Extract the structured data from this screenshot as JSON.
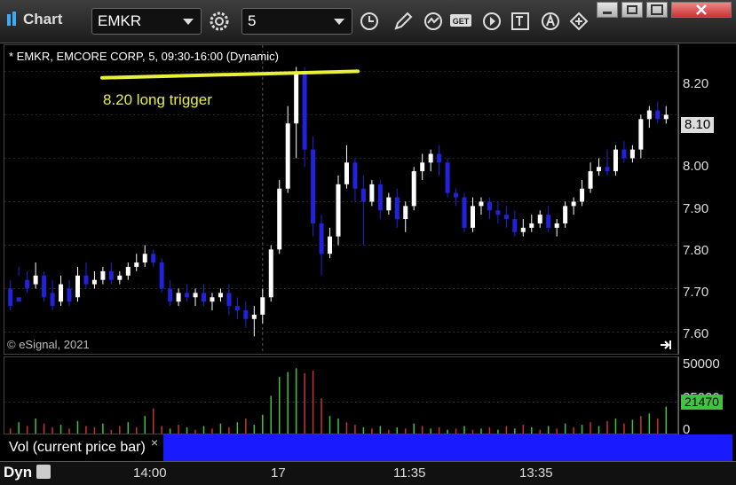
{
  "toolbar": {
    "app_title": "Chart",
    "symbol_value": "EMKR",
    "interval_value": "5",
    "icons": [
      "settings-gear-icon",
      "clock-icon",
      "pencil-icon",
      "study-icon",
      "get-icon",
      "play-icon",
      "text-tool-icon",
      "alert-icon",
      "cursor-icon"
    ]
  },
  "chart_header": "* EMKR, EMCORE CORP, 5, 09:30-16:00 (Dynamic)",
  "annotation": "8.20 long trigger",
  "copyright": "© eSignal, 2021",
  "price_axis": {
    "ticks": [
      "8.20",
      "8.10",
      "8.00",
      "7.90",
      "7.80",
      "7.70",
      "7.60"
    ],
    "current_price": "8.10"
  },
  "volume_axis": {
    "ticks": [
      "50000",
      "25000",
      "0"
    ],
    "current_volume": "21470"
  },
  "volume_label": "Vol (current price bar)",
  "x_axis": {
    "labels": [
      "14:00",
      "17",
      "11:35",
      "13:35"
    ],
    "mode_label": "Dyn"
  },
  "colors": {
    "up": "#ffffff",
    "down": "#2222dd",
    "trigger_line": "#e8f03a",
    "vol_up": "#3ec43e",
    "vol_down": "#c83232"
  },
  "chart_data": {
    "type": "candlestick",
    "ylim": [
      7.55,
      8.26
    ],
    "candles": [
      [
        7.7,
        7.72,
        7.66,
        7.65
      ],
      [
        7.68,
        7.75,
        7.67,
        7.73
      ],
      [
        7.72,
        7.74,
        7.7,
        7.69
      ],
      [
        7.71,
        7.76,
        7.73,
        7.7
      ],
      [
        7.73,
        7.74,
        7.68,
        7.67
      ],
      [
        7.69,
        7.72,
        7.66,
        7.65
      ],
      [
        7.67,
        7.73,
        7.71,
        7.66
      ],
      [
        7.7,
        7.72,
        7.67,
        7.66
      ],
      [
        7.68,
        7.75,
        7.73,
        7.67
      ],
      [
        7.73,
        7.76,
        7.71,
        7.7
      ],
      [
        7.71,
        7.74,
        7.72,
        7.7
      ],
      [
        7.72,
        7.75,
        7.74,
        7.71
      ],
      [
        7.74,
        7.76,
        7.72,
        7.71
      ],
      [
        7.72,
        7.74,
        7.73,
        7.71
      ],
      [
        7.73,
        7.76,
        7.75,
        7.72
      ],
      [
        7.75,
        7.78,
        7.76,
        7.74
      ],
      [
        7.76,
        7.8,
        7.78,
        7.75
      ],
      [
        7.78,
        7.79,
        7.76,
        7.75
      ],
      [
        7.76,
        7.77,
        7.7,
        7.69
      ],
      [
        7.7,
        7.72,
        7.67,
        7.66
      ],
      [
        7.67,
        7.7,
        7.69,
        7.66
      ],
      [
        7.69,
        7.71,
        7.68,
        7.67
      ],
      [
        7.68,
        7.7,
        7.69,
        7.66
      ],
      [
        7.69,
        7.71,
        7.67,
        7.66
      ],
      [
        7.67,
        7.69,
        7.68,
        7.65
      ],
      [
        7.68,
        7.7,
        7.69,
        7.67
      ],
      [
        7.69,
        7.71,
        7.66,
        7.64
      ],
      [
        7.66,
        7.68,
        7.65,
        7.63
      ],
      [
        7.65,
        7.67,
        7.63,
        7.61
      ],
      [
        7.63,
        7.66,
        7.64,
        7.59
      ],
      [
        7.64,
        7.7,
        7.68,
        7.62
      ],
      [
        7.68,
        7.8,
        7.79,
        7.67
      ],
      [
        7.79,
        7.95,
        7.93,
        7.78
      ],
      [
        7.93,
        8.12,
        8.08,
        7.92
      ],
      [
        8.08,
        8.21,
        8.2,
        8.0
      ],
      [
        8.2,
        8.21,
        8.02,
        7.98
      ],
      [
        8.02,
        8.05,
        7.85,
        7.82
      ],
      [
        7.85,
        7.87,
        7.78,
        7.73
      ],
      [
        7.78,
        7.84,
        7.82,
        7.77
      ],
      [
        7.82,
        7.96,
        7.94,
        7.8
      ],
      [
        7.94,
        8.03,
        7.99,
        7.93
      ],
      [
        7.99,
        8.0,
        7.93,
        7.9
      ],
      [
        7.93,
        7.96,
        7.9,
        7.8
      ],
      [
        7.9,
        7.95,
        7.94,
        7.89
      ],
      [
        7.94,
        7.95,
        7.88,
        7.86
      ],
      [
        7.88,
        7.92,
        7.91,
        7.87
      ],
      [
        7.91,
        7.93,
        7.86,
        7.84
      ],
      [
        7.86,
        7.9,
        7.89,
        7.83
      ],
      [
        7.89,
        7.98,
        7.97,
        7.88
      ],
      [
        7.97,
        8.01,
        7.99,
        7.95
      ],
      [
        7.99,
        8.02,
        8.01,
        7.97
      ],
      [
        8.01,
        8.03,
        7.99,
        7.96
      ],
      [
        7.99,
        8.0,
        7.92,
        7.91
      ],
      [
        7.92,
        7.93,
        7.91,
        7.89
      ],
      [
        7.91,
        7.92,
        7.84,
        7.83
      ],
      [
        7.84,
        7.91,
        7.89,
        7.83
      ],
      [
        7.89,
        7.91,
        7.9,
        7.87
      ],
      [
        7.9,
        7.91,
        7.88,
        7.86
      ],
      [
        7.88,
        7.9,
        7.87,
        7.85
      ],
      [
        7.87,
        7.89,
        7.86,
        7.84
      ],
      [
        7.86,
        7.88,
        7.83,
        7.82
      ],
      [
        7.83,
        7.86,
        7.84,
        7.82
      ],
      [
        7.84,
        7.87,
        7.85,
        7.83
      ],
      [
        7.85,
        7.88,
        7.87,
        7.84
      ],
      [
        7.87,
        7.89,
        7.84,
        7.83
      ],
      [
        7.84,
        7.86,
        7.85,
        7.82
      ],
      [
        7.85,
        7.9,
        7.89,
        7.84
      ],
      [
        7.89,
        7.91,
        7.9,
        7.87
      ],
      [
        7.9,
        7.95,
        7.93,
        7.89
      ],
      [
        7.93,
        7.99,
        7.97,
        7.92
      ],
      [
        7.97,
        8.0,
        7.98,
        7.96
      ],
      [
        7.98,
        8.02,
        7.97,
        7.96
      ],
      [
        7.97,
        8.03,
        8.02,
        7.96
      ],
      [
        8.02,
        8.04,
        8.0,
        7.99
      ],
      [
        8.0,
        8.03,
        8.02,
        7.99
      ],
      [
        8.02,
        8.1,
        8.09,
        8.0
      ],
      [
        8.09,
        8.12,
        8.11,
        8.07
      ],
      [
        8.11,
        8.13,
        8.09,
        8.08
      ],
      [
        8.09,
        8.12,
        8.1,
        8.08
      ]
    ],
    "volumes": [
      [
        4000,
        1
      ],
      [
        9000,
        0
      ],
      [
        6000,
        1
      ],
      [
        12000,
        0
      ],
      [
        8000,
        1
      ],
      [
        5000,
        1
      ],
      [
        7000,
        0
      ],
      [
        4000,
        1
      ],
      [
        10000,
        0
      ],
      [
        6000,
        1
      ],
      [
        5000,
        1
      ],
      [
        8000,
        0
      ],
      [
        3000,
        1
      ],
      [
        6000,
        1
      ],
      [
        9000,
        0
      ],
      [
        5000,
        1
      ],
      [
        14000,
        0
      ],
      [
        20000,
        1
      ],
      [
        6000,
        1
      ],
      [
        4000,
        0
      ],
      [
        7000,
        1
      ],
      [
        5000,
        0
      ],
      [
        3000,
        1
      ],
      [
        6000,
        0
      ],
      [
        4000,
        1
      ],
      [
        8000,
        0
      ],
      [
        5000,
        1
      ],
      [
        9000,
        0
      ],
      [
        12000,
        1
      ],
      [
        7000,
        0
      ],
      [
        15000,
        0
      ],
      [
        30000,
        0
      ],
      [
        45000,
        0
      ],
      [
        49000,
        0
      ],
      [
        52000,
        0
      ],
      [
        48000,
        1
      ],
      [
        50000,
        1
      ],
      [
        28000,
        1
      ],
      [
        14000,
        0
      ],
      [
        12000,
        0
      ],
      [
        9000,
        1
      ],
      [
        7000,
        1
      ],
      [
        5000,
        0
      ],
      [
        4000,
        1
      ],
      [
        6000,
        0
      ],
      [
        3000,
        1
      ],
      [
        5000,
        0
      ],
      [
        4000,
        1
      ],
      [
        8000,
        0
      ],
      [
        6000,
        1
      ],
      [
        4000,
        0
      ],
      [
        5000,
        1
      ],
      [
        3000,
        0
      ],
      [
        4000,
        1
      ],
      [
        6000,
        0
      ],
      [
        3000,
        1
      ],
      [
        4000,
        0
      ],
      [
        5000,
        1
      ],
      [
        3000,
        0
      ],
      [
        6000,
        1
      ],
      [
        4000,
        0
      ],
      [
        7000,
        1
      ],
      [
        5000,
        0
      ],
      [
        3000,
        1
      ],
      [
        6000,
        0
      ],
      [
        4000,
        1
      ],
      [
        8000,
        0
      ],
      [
        5000,
        1
      ],
      [
        7000,
        0
      ],
      [
        9000,
        1
      ],
      [
        6000,
        0
      ],
      [
        10000,
        1
      ],
      [
        12000,
        0
      ],
      [
        8000,
        1
      ],
      [
        11000,
        0
      ],
      [
        14000,
        1
      ],
      [
        16000,
        0
      ],
      [
        12000,
        1
      ],
      [
        21470,
        0
      ]
    ],
    "vol_ylim": [
      0,
      55000
    ]
  }
}
